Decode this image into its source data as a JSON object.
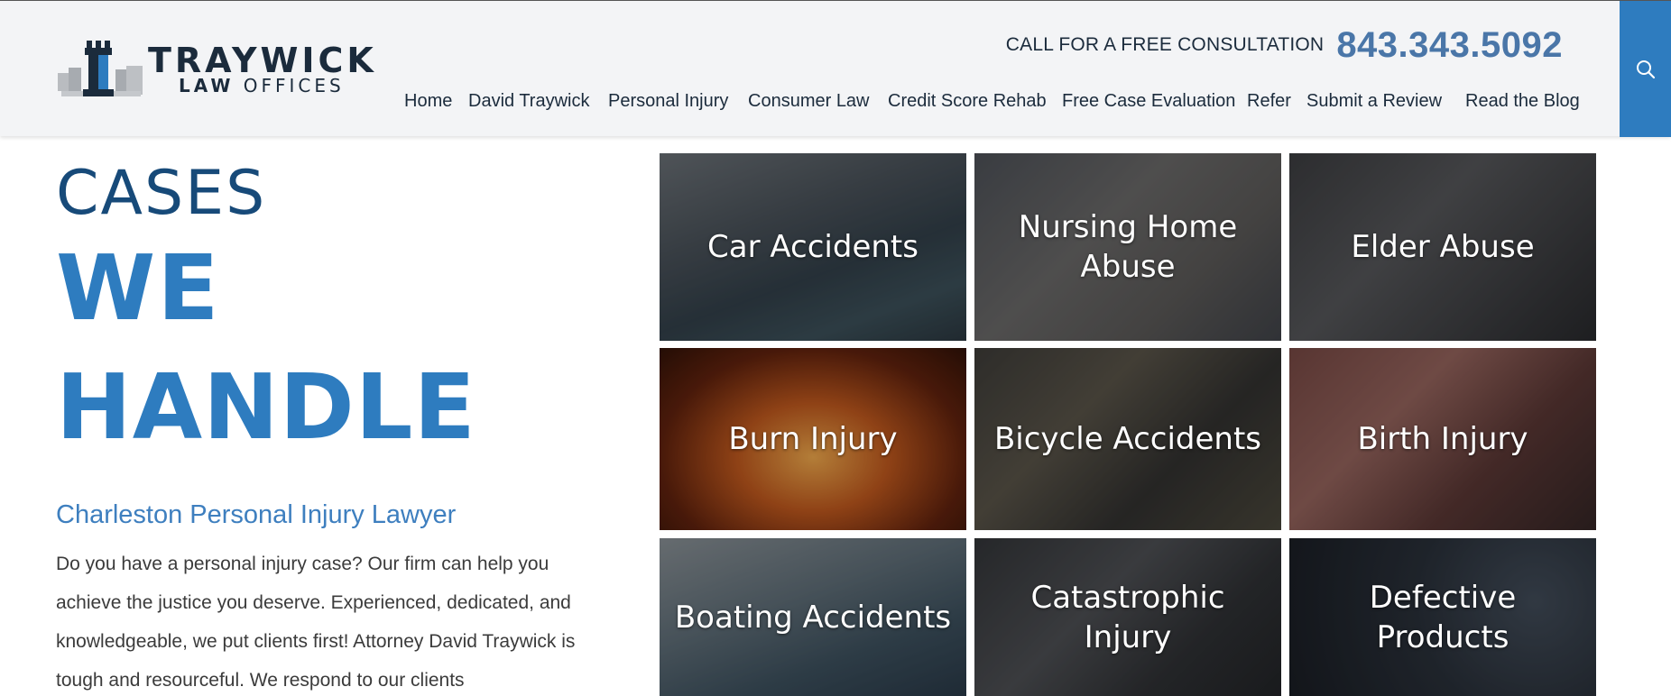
{
  "header": {
    "logo_main": "TRAYWICK",
    "logo_sub_left": "LAW",
    "logo_sub_right": "OFFICES",
    "cta_label": "CALL FOR A FREE CONSULTATION",
    "cta_phone": "843.343.5092",
    "search_icon": "search-icon"
  },
  "nav": {
    "items": [
      {
        "label": "Home"
      },
      {
        "label": "David Traywick"
      },
      {
        "label": "Personal Injury"
      },
      {
        "label": "Consumer Law"
      },
      {
        "label": "Credit Score Rehab"
      },
      {
        "label": "Free Case Evaluation"
      },
      {
        "label": "Refer"
      },
      {
        "label": "Submit a Review"
      },
      {
        "label": "Read the Blog"
      }
    ]
  },
  "hero": {
    "line1": "CASES",
    "line2": "WE",
    "line3": "HANDLE",
    "subhead": "Charleston Personal Injury Lawyer",
    "body": "Do you have a personal injury case? Our firm can help you achieve the justice you deserve. Experienced, dedicated, and knowledgeable, we put clients first! Attorney David Traywick is tough and resourceful. We respond to our clients"
  },
  "cases": [
    {
      "label": "Car Accidents"
    },
    {
      "label": "Nursing Home Abuse"
    },
    {
      "label": "Elder Abuse"
    },
    {
      "label": "Burn Injury"
    },
    {
      "label": "Bicycle Accidents"
    },
    {
      "label": "Birth Injury"
    },
    {
      "label": "Boating Accidents"
    },
    {
      "label": "Catastrophic Injury"
    },
    {
      "label": "Defective Products"
    }
  ],
  "colors": {
    "brand_blue": "#2e7cbf",
    "navy": "#174a79",
    "phone_blue": "#4a76a8",
    "header_bg": "#f3f4f6"
  }
}
